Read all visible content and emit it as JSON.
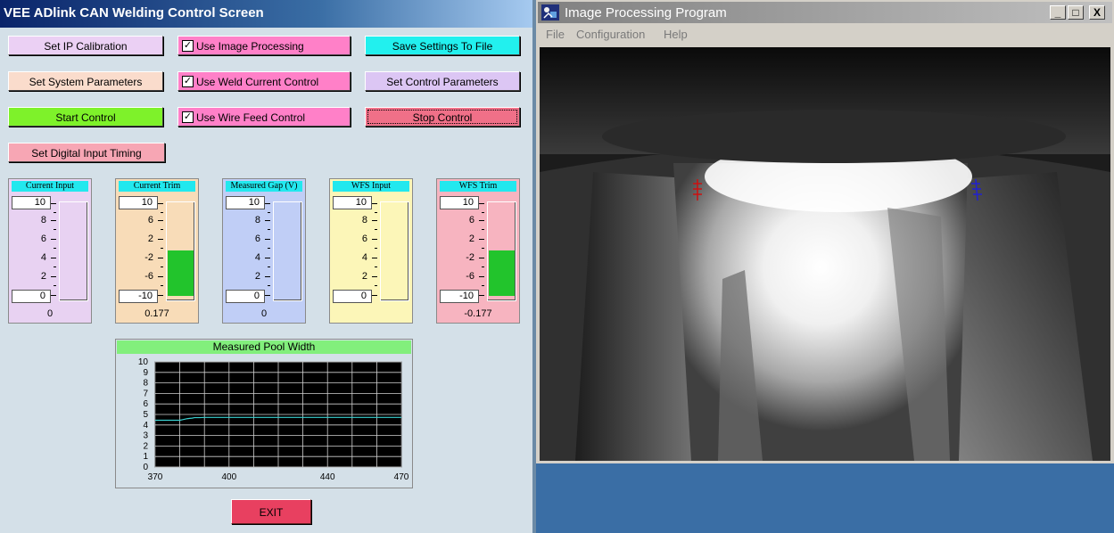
{
  "vee": {
    "title": "VEE ADlink CAN Welding Control Screen",
    "buttons": {
      "set_ip": "Set IP Calibration",
      "set_system": "Set System Parameters",
      "start": "Start Control",
      "set_digital": "Set Digital Input Timing",
      "save": "Save Settings To File",
      "set_control": "Set Control Parameters",
      "stop": "Stop Control",
      "exit": "EXIT"
    },
    "checkboxes": [
      {
        "label": "Use Image Processing",
        "checked": "✓"
      },
      {
        "label": "Use Weld Current Control",
        "checked": "✓"
      },
      {
        "label": "Use Wire Feed Control",
        "checked": "✓"
      }
    ],
    "gauges": [
      {
        "title": "Current Input",
        "top": "10",
        "bottom": "0",
        "ticks": [
          "8",
          "6",
          "4",
          "2"
        ],
        "value": "0",
        "fill_fraction": 0,
        "color": "#e8d2f2"
      },
      {
        "title": "Current Trim",
        "top": "10",
        "bottom": "-10",
        "ticks": [
          "6",
          "2",
          "-2",
          "-6"
        ],
        "value": "0.177",
        "fill_fraction": 0.51,
        "color": "#f8dcb8"
      },
      {
        "title": "Measured Gap (V)",
        "top": "10",
        "bottom": "0",
        "ticks": [
          "8",
          "6",
          "4",
          "2"
        ],
        "value": "0",
        "fill_fraction": 0,
        "color": "#c0cef6"
      },
      {
        "title": "WFS Input",
        "top": "10",
        "bottom": "0",
        "ticks": [
          "8",
          "6",
          "4",
          "2"
        ],
        "value": "",
        "fill_fraction": 0,
        "color": "#fcf6b8"
      },
      {
        "title": "WFS Trim",
        "top": "10",
        "bottom": "-10",
        "ticks": [
          "6",
          "2",
          "-2",
          "-6"
        ],
        "value": "-0.177",
        "fill_fraction": 0.5,
        "color": "#f7b4c0"
      }
    ]
  },
  "chart_data": {
    "type": "line",
    "title": "Measured Pool Width",
    "xlabel": "",
    "ylabel": "",
    "xlim": [
      370,
      470
    ],
    "ylim": [
      0,
      10
    ],
    "xticks": [
      "370",
      "400",
      "440",
      "470"
    ],
    "yticks": [
      "0",
      "1",
      "2",
      "3",
      "4",
      "5",
      "6",
      "7",
      "8",
      "9",
      "10"
    ],
    "grid": true,
    "series": [
      {
        "x": [
          370,
          380,
          381,
          382,
          383,
          384,
          385,
          386,
          388,
          390,
          470
        ],
        "values": [
          4.45,
          4.45,
          4.5,
          4.55,
          4.6,
          4.63,
          4.65,
          4.7,
          4.7,
          4.72,
          4.72
        ]
      }
    ],
    "line_color": "#3ad0d0",
    "background": "#000000"
  },
  "ipw": {
    "title": "Image Processing Program",
    "menu": [
      "File",
      "Configuration",
      "Help"
    ],
    "window_buttons": [
      "_",
      "□",
      "X"
    ]
  }
}
